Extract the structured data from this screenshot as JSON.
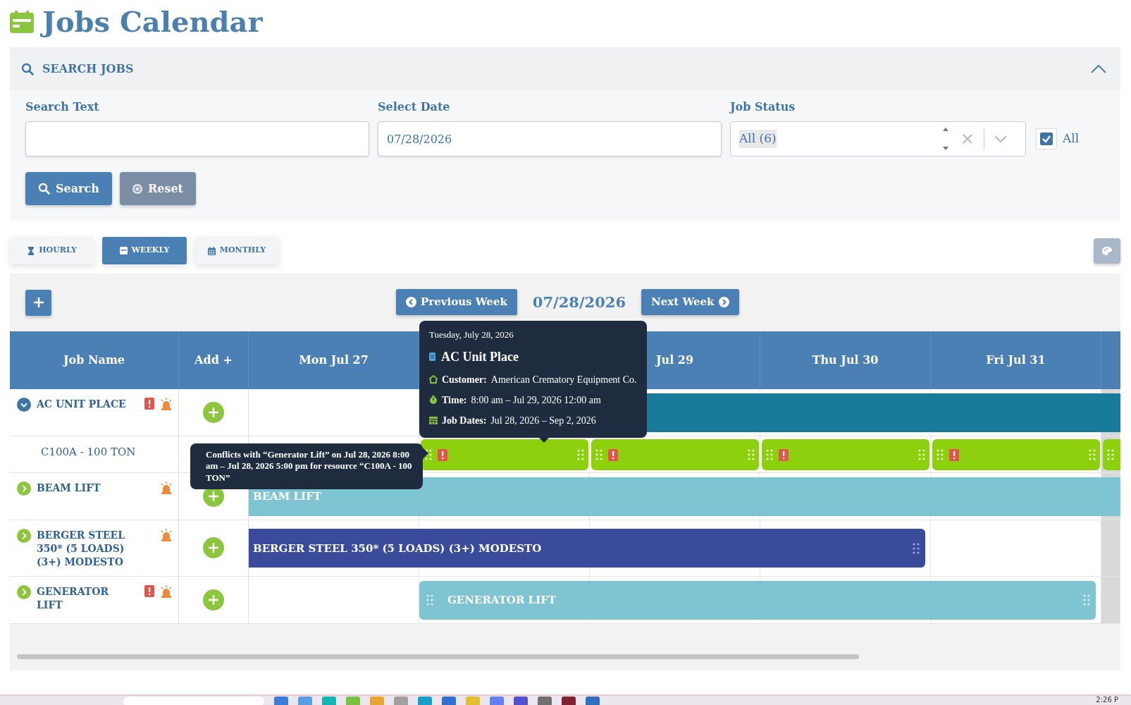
{
  "header": {
    "title": "Jobs Calendar"
  },
  "search_panel": {
    "title": "SEARCH JOBS",
    "expanded": true,
    "fields": [
      {
        "label": "Search Text",
        "kind": "text"
      },
      {
        "label": "Select Date",
        "kind": "text",
        "value": "07/28/2026"
      },
      {
        "label": "Job Status",
        "kind": "select",
        "value": "All (6)"
      }
    ],
    "all_checkbox": {
      "label": "All",
      "checked": true
    },
    "buttons": [
      {
        "label": "Search",
        "kind": "primary"
      },
      {
        "label": "Reset",
        "kind": "secondary"
      }
    ]
  },
  "view_tabs": [
    {
      "label": "HOURLY",
      "kind": "hourly",
      "selected": false
    },
    {
      "label": "WEEKLY",
      "kind": "weekly",
      "selected": true
    },
    {
      "label": "MONTHLY",
      "kind": "monthly",
      "selected": false
    }
  ],
  "calendar": {
    "current_date": "07/28/2026",
    "prev_label": "Previous Week",
    "next_label": "Next Week",
    "columns": {
      "job_name": "Job Name",
      "add": "Add +"
    },
    "days": [
      {
        "kind": "day",
        "label": "Mon Jul 27"
      },
      {
        "kind": "covered"
      },
      {
        "kind": "day",
        "label": "Jul 29"
      },
      {
        "kind": "day",
        "label": "Thu Jul 30"
      },
      {
        "kind": "day",
        "label": "Fri Jul 31"
      },
      {
        "kind": "cut"
      }
    ],
    "rows": [
      {
        "name": "AC UNIT PLACE",
        "expanded": true,
        "conflict": true,
        "alarm": true,
        "timeline": [
          {
            "kind": "empty"
          },
          {
            "kind": "bar",
            "color": "#177b99"
          },
          {
            "kind": "continue"
          },
          {
            "kind": "continue"
          },
          {
            "kind": "continue"
          },
          {
            "kind": "continue"
          }
        ],
        "children": [
          {
            "name": "C100A - 100 TON",
            "timeline": [
              {
                "kind": "empty"
              },
              {
                "kind": "segment",
                "color": "#8dd10e",
                "conflict": true
              },
              {
                "kind": "segment",
                "color": "#8dd10e",
                "conflict": true
              },
              {
                "kind": "segment",
                "color": "#8dd10e",
                "conflict": true
              },
              {
                "kind": "segment",
                "color": "#8dd10e",
                "conflict": true
              },
              {
                "kind": "segment",
                "color": "#8dd10e",
                "conflict": false
              }
            ]
          }
        ]
      },
      {
        "name": "BEAM LIFT",
        "expanded": false,
        "conflict": false,
        "alarm": true,
        "timeline": [
          {
            "kind": "bar",
            "color": "#7fc4d3",
            "label": "BEAM LIFT"
          },
          {
            "kind": "continue"
          },
          {
            "kind": "continue"
          },
          {
            "kind": "continue"
          },
          {
            "kind": "continue"
          },
          {
            "kind": "continue"
          }
        ]
      },
      {
        "name": "BERGER STEEL 350* (5 LOADS) (3+) MODESTO",
        "expanded": false,
        "conflict": false,
        "alarm": true,
        "timeline": [
          {
            "kind": "bar",
            "color": "#3a4b9b",
            "label": "BERGER STEEL 350* (5 LOADS) (3+) MODESTO",
            "handle_right": true
          },
          {
            "kind": "continue"
          },
          {
            "kind": "continue"
          },
          {
            "kind": "continue"
          },
          {
            "kind": "empty"
          },
          {
            "kind": "empty"
          }
        ]
      },
      {
        "name": "GENERATOR LIFT",
        "expanded": false,
        "conflict": true,
        "alarm": true,
        "timeline": [
          {
            "kind": "empty"
          },
          {
            "kind": "bar",
            "color": "#7fc4d3",
            "label": "GENERATOR LIFT",
            "handle_left": true,
            "handle_right": true
          },
          {
            "kind": "continue"
          },
          {
            "kind": "continue"
          },
          {
            "kind": "continue"
          },
          {
            "kind": "empty"
          }
        ]
      }
    ],
    "event_tooltip": {
      "date": "Tuesday, July 28, 2026",
      "title": "AC Unit Place",
      "lines": [
        {
          "kind": "customer",
          "label": "Customer:",
          "value": "American Crematory Equipment Co."
        },
        {
          "kind": "time",
          "label": "Time:",
          "value": "8:00 am – Jul 29, 2026 12:00 am"
        },
        {
          "kind": "dates",
          "label": "Job Dates:",
          "value": "Jul 28, 2026 – Sep 2, 2026"
        }
      ]
    },
    "conflict_tooltip": {
      "text": "Conflicts with “Generator Lift” on Jul 28, 2026 8:00 am – Jul 28, 2026 5:00 pm for resource “C100A - 100 TON”"
    }
  },
  "taskbar": {
    "clock": "2:26 P"
  }
}
